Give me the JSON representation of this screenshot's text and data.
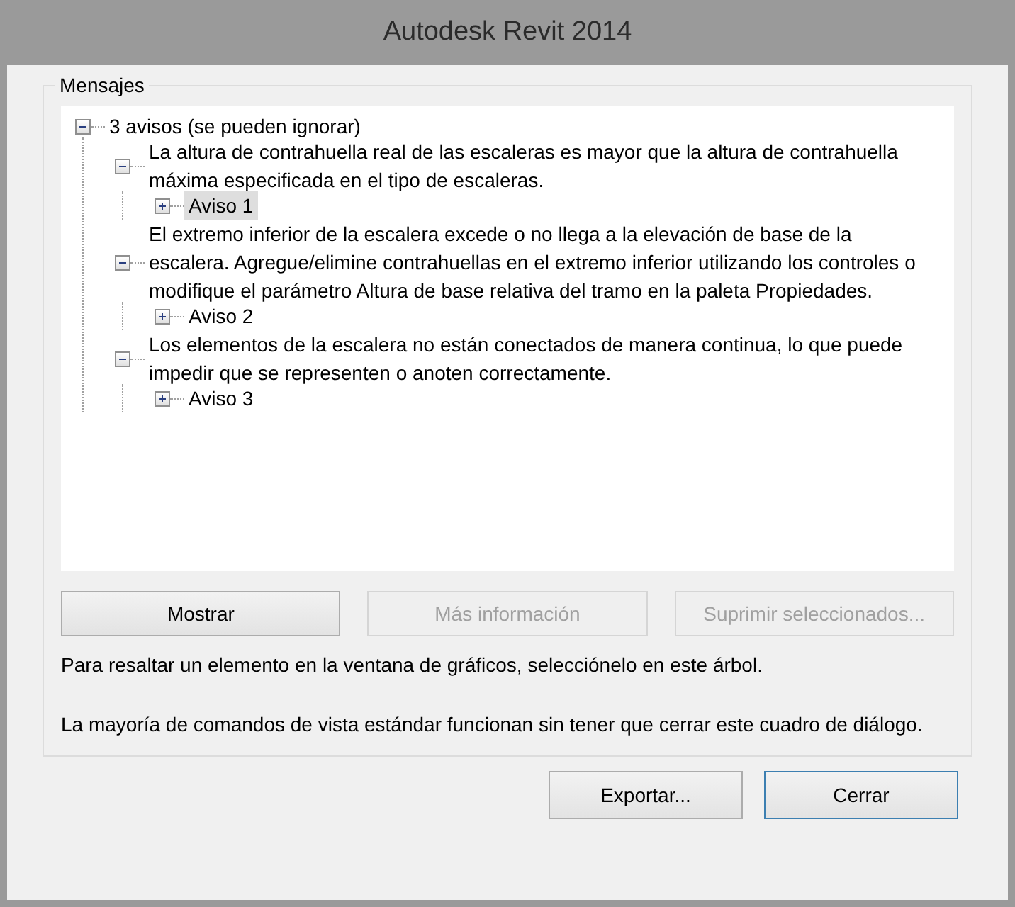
{
  "window": {
    "title": "Autodesk Revit 2014"
  },
  "group": {
    "label": "Mensajes"
  },
  "tree": [
    {
      "text": "3 avisos (se pueden ignorar)",
      "expanded": true,
      "selected": false,
      "children": [
        {
          "text": "La altura de contrahuella real de las escaleras es mayor que la altura de contrahuella máxima especificada en el tipo de escaleras.",
          "expanded": true,
          "selected": false,
          "children": [
            {
              "text": "Aviso 1",
              "expanded": false,
              "selected": true
            }
          ]
        },
        {
          "text": "El extremo inferior de la escalera excede o no llega a la elevación de base de la escalera. Agregue/elimine contrahuellas en el extremo inferior utilizando los controles o modifique el parámetro Altura de base relativa del tramo en la paleta Propiedades.",
          "expanded": true,
          "selected": false,
          "children": [
            {
              "text": "Aviso 2",
              "expanded": false,
              "selected": false
            }
          ]
        },
        {
          "text": "Los elementos de la escalera no están conectados de manera continua, lo que puede impedir que se representen o anoten correctamente.",
          "expanded": true,
          "selected": false,
          "children": [
            {
              "text": "Aviso 3",
              "expanded": false,
              "selected": false
            }
          ]
        }
      ]
    }
  ],
  "actions": [
    {
      "label": "Mostrar",
      "disabled": false
    },
    {
      "label": "Más información",
      "disabled": true
    },
    {
      "label": "Suprimir seleccionados...",
      "disabled": true
    }
  ],
  "hint": "Para resaltar un elemento en la ventana de gráficos, selecciónelo en este árbol.",
  "note": "La mayoría de comandos de vista estándar funcionan sin tener que cerrar este cuadro de diálogo.",
  "footer_buttons": [
    {
      "label": "Exportar...",
      "default": false
    },
    {
      "label": "Cerrar",
      "default": true
    }
  ]
}
